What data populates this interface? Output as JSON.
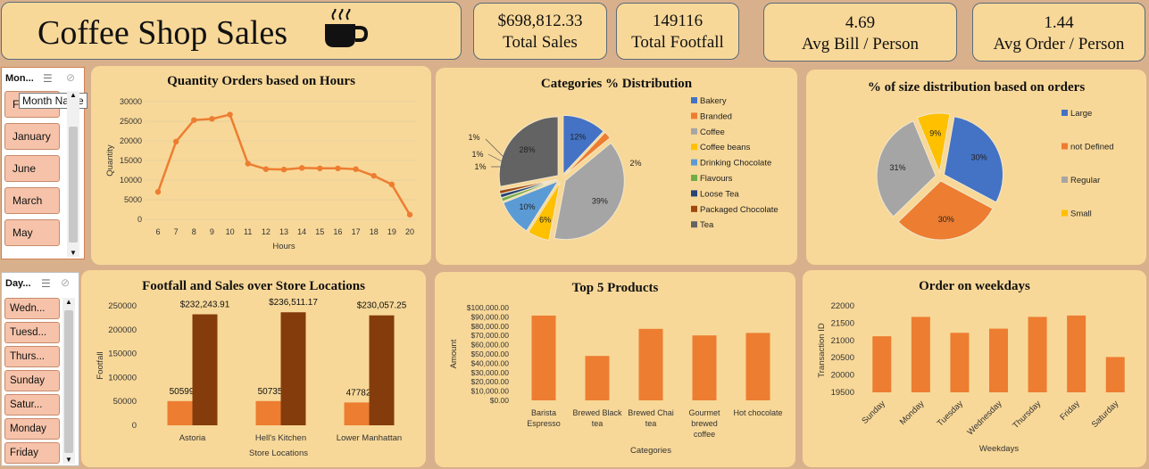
{
  "header": {
    "title": "Coffee Shop Sales",
    "cup_icon": "coffee-cup-icon"
  },
  "kpis": [
    {
      "value": "$698,812.33",
      "label": "Total Sales"
    },
    {
      "value": "149116",
      "label": "Total Footfall"
    },
    {
      "value": "4.69",
      "label": "Avg Bill /  Person"
    },
    {
      "value": "1.44",
      "label": "Avg Order / Person"
    }
  ],
  "month_slicer": {
    "title": "Mon...",
    "tooltip": "Month Name",
    "items": [
      "February",
      "January",
      "June",
      "March",
      "May"
    ],
    "first_visible": "F"
  },
  "day_slicer": {
    "title": "Day...",
    "items": [
      "Wedn...",
      "Tuesd...",
      "Thurs...",
      "Sunday",
      "Satur...",
      "Monday",
      "Friday"
    ]
  },
  "chart_data": [
    {
      "type": "line",
      "title": "Quantity Orders based on Hours",
      "xlabel": "Hours",
      "ylabel": "Quantity",
      "x": [
        6,
        7,
        8,
        9,
        10,
        11,
        12,
        13,
        14,
        15,
        16,
        17,
        18,
        19,
        20
      ],
      "values": [
        7000,
        19800,
        25300,
        25600,
        26700,
        14200,
        12800,
        12700,
        13100,
        13000,
        13000,
        12800,
        11100,
        8900,
        1200
      ],
      "yticks": [
        "30000",
        "25000",
        "20000",
        "15000",
        "10000",
        "5000",
        "0"
      ],
      "ylim": [
        0,
        30000
      ],
      "color": "#ed7d31"
    },
    {
      "type": "pie",
      "title": "Categories  % Distribution",
      "slices": [
        {
          "name": "Bakery",
          "value": 12,
          "label": "12%",
          "color": "#4472c4"
        },
        {
          "name": "Branded",
          "value": 2,
          "label": "2%",
          "color": "#ed7d31"
        },
        {
          "name": "Coffee",
          "value": 39,
          "label": "39%",
          "color": "#a5a5a5"
        },
        {
          "name": "Coffee beans",
          "value": 6,
          "label": "6%",
          "color": "#ffc000"
        },
        {
          "name": "Drinking Chocolate",
          "value": 10,
          "label": "10%",
          "color": "#5b9bd5"
        },
        {
          "name": "Flavours",
          "value": 1,
          "label": "1%",
          "color": "#70ad47"
        },
        {
          "name": "Loose Tea",
          "value": 1,
          "label": "1%",
          "color": "#264478"
        },
        {
          "name": "Packaged Chocolate",
          "value": 1,
          "label": "1%",
          "color": "#9e480e"
        },
        {
          "name": "Tea",
          "value": 28,
          "label": "28%",
          "color": "#636363"
        }
      ]
    },
    {
      "type": "pie",
      "title": "% of size distribution based on orders",
      "slices": [
        {
          "name": "Large",
          "value": 30,
          "label": "30%",
          "color": "#4472c4"
        },
        {
          "name": "not Defined",
          "value": 30,
          "label": "30%",
          "color": "#ed7d31"
        },
        {
          "name": "Regular",
          "value": 31,
          "label": "31%",
          "color": "#a5a5a5"
        },
        {
          "name": "Small",
          "value": 9,
          "label": "9%",
          "color": "#ffc000"
        }
      ]
    },
    {
      "type": "bar",
      "title": "Footfall and Sales over Store Locations",
      "xlabel": "Store Locations",
      "ylabel": "Footfall",
      "categories": [
        "Astoria",
        "Hell's Kitchen",
        "Lower Manhattan"
      ],
      "series": [
        {
          "values": [
            50599,
            50735,
            47782
          ],
          "labels": [
            "50599",
            "50735",
            "47782"
          ],
          "color": "#ed7d31"
        },
        {
          "values": [
            232243.91,
            236511.17,
            230057.25
          ],
          "labels": [
            "$232,243.91",
            "$236,511.17",
            "$230,057.25"
          ],
          "color": "#843c0c"
        }
      ],
      "yticks": [
        "250000",
        "200000",
        "150000",
        "100000",
        "50000",
        "0"
      ],
      "ylim": [
        0,
        250000
      ]
    },
    {
      "type": "bar",
      "title": "Top 5 Products",
      "xlabel": "Categories",
      "ylabel": "Amount",
      "categories": [
        [
          "Barista",
          "Espresso"
        ],
        [
          "Brewed Black",
          "tea"
        ],
        [
          "Brewed Chai",
          "tea"
        ],
        [
          "Gourmet",
          "brewed",
          "coffee"
        ],
        [
          "Hot chocolate"
        ]
      ],
      "values": [
        91400,
        47900,
        77100,
        70000,
        72700
      ],
      "yticks": [
        "$100,000.00",
        "$90,000.00",
        "$80,000.00",
        "$70,000.00",
        "$60,000.00",
        "$50,000.00",
        "$40,000.00",
        "$30,000.00",
        "$20,000.00",
        "$10,000.00",
        "$0.00"
      ],
      "ylim": [
        0,
        100000
      ],
      "color": "#ed7d31"
    },
    {
      "type": "bar",
      "title": "Order on weekdays",
      "xlabel": "Weekdays",
      "ylabel": "Transaction ID",
      "categories": [
        "Sunday",
        "Monday",
        "Tuesday",
        "Wednesday",
        "Thursday",
        "Friday",
        "Saturday"
      ],
      "values": [
        21120,
        21680,
        21220,
        21340,
        21680,
        21720,
        20520
      ],
      "yticks": [
        "22000",
        "21500",
        "21000",
        "20500",
        "20000",
        "19500"
      ],
      "ylim": [
        19500,
        22000
      ],
      "color": "#ed7d31"
    }
  ]
}
